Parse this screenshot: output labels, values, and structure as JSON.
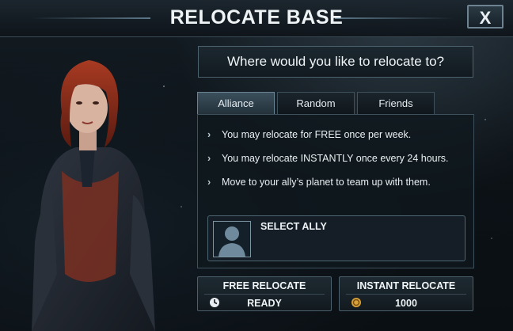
{
  "header": {
    "title": "RELOCATE BASE",
    "close_label": "X"
  },
  "prompt": "Where would you like to relocate to?",
  "tabs": [
    {
      "label": "Alliance",
      "active": true
    },
    {
      "label": "Random",
      "active": false
    },
    {
      "label": "Friends",
      "active": false
    }
  ],
  "info_lines": [
    "You may relocate for FREE once per week.",
    "You may relocate INSTANTLY once every 24 hours.",
    "Move to your ally’s planet to team up with them."
  ],
  "ally": {
    "label": "SELECT ALLY",
    "avatar_icon": "silhouette-icon"
  },
  "free_relocate": {
    "label": "FREE RELOCATE",
    "status": "READY",
    "icon": "clock-icon"
  },
  "instant_relocate": {
    "label": "INSTANT RELOCATE",
    "cost": "1000",
    "icon": "coin-icon"
  },
  "colors": {
    "background": "#0b1116",
    "panel_border": "#4d626f",
    "active_tab": "#3a4f5c",
    "text": "#e7eef2",
    "coin": "#d8a23a"
  }
}
